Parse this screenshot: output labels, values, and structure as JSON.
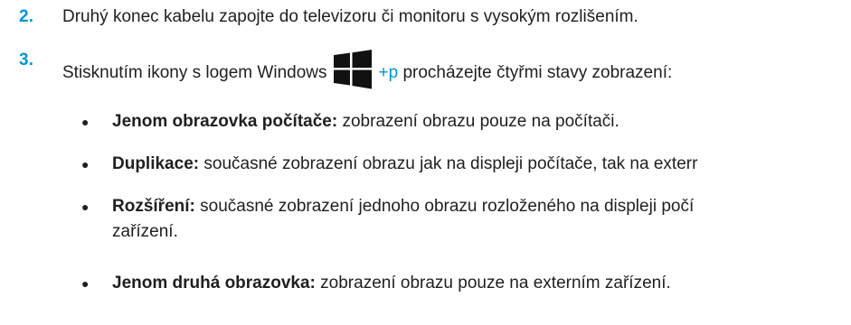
{
  "steps": [
    {
      "number": "2.",
      "text": "Druhý konec kabelu zapojte do televizoru či monitoru s vysokým rozlišením."
    },
    {
      "number": "3.",
      "text_before": "Stisknutím ikony s logem Windows",
      "plus": "+",
      "key": "p",
      "text_after": " procházejte čtyřmi stavy zobrazení:"
    }
  ],
  "bullets": [
    {
      "term": "Jenom obrazovka počítače:",
      "text": " zobrazení obrazu pouze na počítači."
    },
    {
      "term": "Duplikace:",
      "text": " současné zobrazení obrazu jak na displeji počítače, tak na exterr"
    },
    {
      "term": "Rozšíření:",
      "text": " současné zobrazení jednoho obrazu rozloženého na displeji počí",
      "continuation": "zařízení."
    },
    {
      "term": "Jenom druhá obrazovka:",
      "text": " zobrazení obrazu pouze na externím zařízení."
    }
  ],
  "bullet_symbol": "●",
  "icons": {
    "windows": "windows-logo-icon"
  },
  "colors": {
    "accent": "#0096d6",
    "text": "#1f1f1f",
    "logo": "#111111"
  }
}
